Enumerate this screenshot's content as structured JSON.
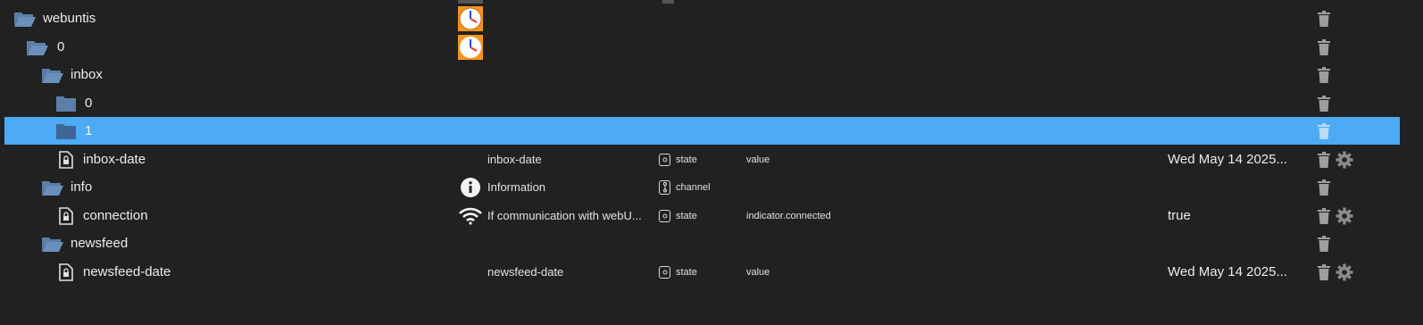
{
  "rows": [
    {
      "name": "webuntis",
      "role": "",
      "type": "",
      "obj_role": "",
      "value": "",
      "icon": "folder-open-icon",
      "has_app_icon": true
    },
    {
      "name": "0",
      "role": "",
      "type": "",
      "obj_role": "",
      "value": "",
      "icon": "folder-open-icon",
      "has_app_icon": true
    },
    {
      "name": "inbox",
      "role": "",
      "type": "",
      "obj_role": "",
      "value": "",
      "icon": "folder-open-icon"
    },
    {
      "name": "0",
      "role": "",
      "type": "",
      "obj_role": "",
      "value": "",
      "icon": "folder-closed-icon"
    },
    {
      "name": "1",
      "role": "",
      "type": "",
      "obj_role": "",
      "value": "",
      "icon": "folder-closed-icon",
      "selected": true
    },
    {
      "name": "inbox-date",
      "role": "inbox-date",
      "type": "state",
      "obj_role": "value",
      "value": "Wed May 14 2025...",
      "icon": "state-file-icon",
      "settings": true
    },
    {
      "name": "info",
      "role": "Information",
      "type": "channel",
      "obj_role": "",
      "value": "",
      "icon": "folder-open-icon",
      "role_icon": "info-circle-icon"
    },
    {
      "name": "connection",
      "role": "If communication with webU...",
      "type": "state",
      "obj_role": "indicator.connected",
      "value": "true",
      "icon": "state-file-icon",
      "role_icon": "wifi-icon",
      "settings": true
    },
    {
      "name": "newsfeed",
      "role": "",
      "type": "",
      "obj_role": "",
      "value": "",
      "icon": "folder-open-icon"
    },
    {
      "name": "newsfeed-date",
      "role": "newsfeed-date",
      "type": "state",
      "obj_role": "value",
      "value": "Wed May 14 2025...",
      "icon": "state-file-icon",
      "settings": true
    }
  ],
  "colors": {
    "background": "#212121",
    "selected_row": "#4dabf5",
    "folder": "#5b7fa8",
    "text": "#ececec",
    "action_icon": "#9e9e9e"
  }
}
